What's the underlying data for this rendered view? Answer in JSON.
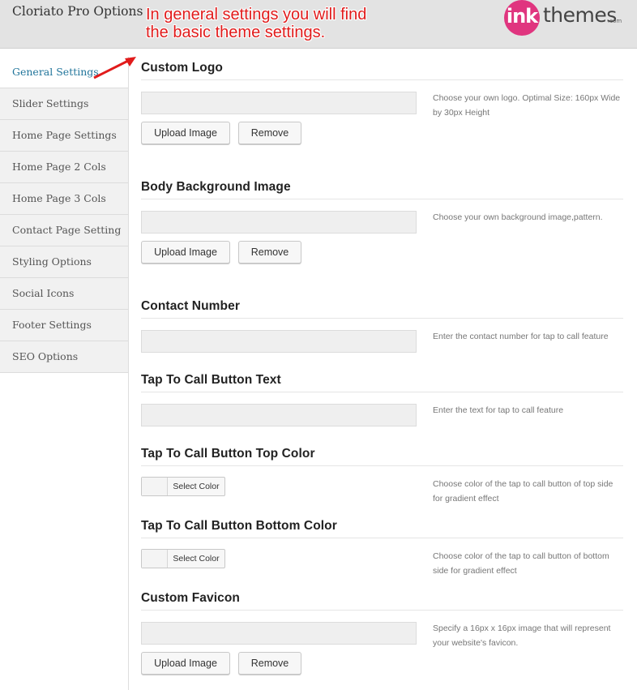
{
  "header": {
    "title": "Cloriato Pro Options",
    "logo": {
      "ink": "ink",
      "themes": "themes",
      "com": ".com"
    }
  },
  "annotation": {
    "text": "In general settings you will find  the basic theme settings.",
    "color": "#e11b1b"
  },
  "sidebar": {
    "items": [
      {
        "label": "General Settings",
        "active": true
      },
      {
        "label": "Slider Settings"
      },
      {
        "label": "Home Page Settings"
      },
      {
        "label": "Home Page 2 Cols"
      },
      {
        "label": "Home Page 3 Cols"
      },
      {
        "label": "Contact Page Setting"
      },
      {
        "label": "Styling Options"
      },
      {
        "label": "Social Icons"
      },
      {
        "label": "Footer Settings"
      },
      {
        "label": "SEO Options"
      }
    ]
  },
  "sections": {
    "custom_logo": {
      "title": "Custom Logo",
      "value": "",
      "desc": "Choose your own logo. Optimal Size: 160px Wide by 30px Height",
      "upload": "Upload Image",
      "remove": "Remove"
    },
    "body_bg": {
      "title": "Body Background Image",
      "value": "",
      "desc": "Choose your own background image,pattern.",
      "upload": "Upload Image",
      "remove": "Remove"
    },
    "contact_number": {
      "title": "Contact Number",
      "value": "",
      "desc": "Enter the contact number for tap to call feature"
    },
    "tap_text": {
      "title": "Tap To Call Button Text",
      "value": "",
      "desc": "Enter the text for tap to call feature"
    },
    "tap_top": {
      "title": "Tap To Call Button Top Color",
      "button": "Select Color",
      "desc": "Choose color of the tap to call button of top side for gradient effect"
    },
    "tap_bottom": {
      "title": "Tap To Call Button Bottom Color",
      "button": "Select Color",
      "desc": "Choose color of the tap to call button of bottom side for gradient effect"
    },
    "favicon": {
      "title": "Custom Favicon",
      "value": "",
      "desc": "Specify a 16px x 16px image that will represent your website's favicon.",
      "upload": "Upload Image",
      "remove": "Remove"
    }
  },
  "colors": {
    "accent": "#21759b",
    "logo_pink": "#e0357f"
  }
}
